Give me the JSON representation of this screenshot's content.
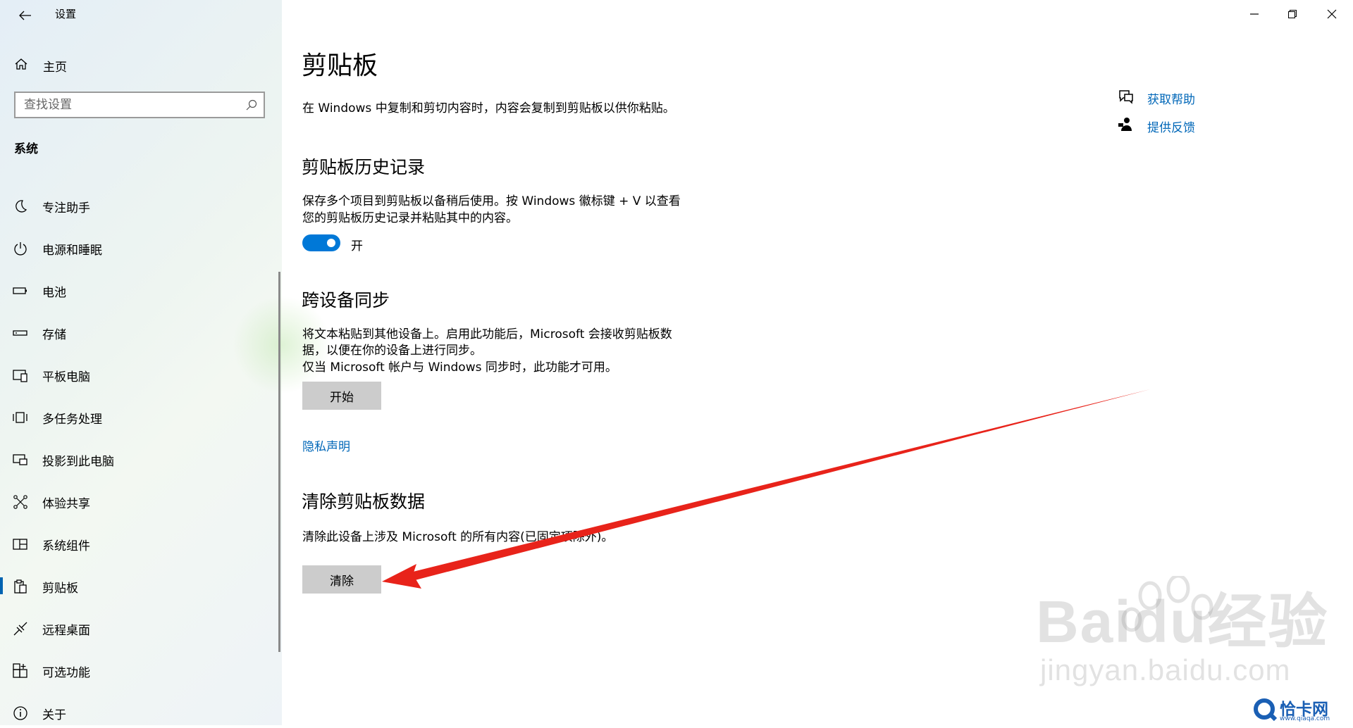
{
  "app": {
    "title": "设置"
  },
  "sidebar": {
    "home_label": "主页",
    "search_placeholder": "查找设置",
    "group_label": "系统",
    "items": [
      {
        "label": "专注助手",
        "icon": "moon-icon"
      },
      {
        "label": "电源和睡眠",
        "icon": "power-icon"
      },
      {
        "label": "电池",
        "icon": "battery-icon"
      },
      {
        "label": "存储",
        "icon": "storage-icon"
      },
      {
        "label": "平板电脑",
        "icon": "tablet-icon"
      },
      {
        "label": "多任务处理",
        "icon": "multitasking-icon"
      },
      {
        "label": "投影到此电脑",
        "icon": "project-icon"
      },
      {
        "label": "体验共享",
        "icon": "shared-experiences-icon"
      },
      {
        "label": "系统组件",
        "icon": "system-components-icon"
      },
      {
        "label": "剪贴板",
        "icon": "clipboard-icon",
        "active": true
      },
      {
        "label": "远程桌面",
        "icon": "remote-desktop-icon"
      },
      {
        "label": "可选功能",
        "icon": "optional-features-icon"
      },
      {
        "label": "关于",
        "icon": "info-icon"
      }
    ]
  },
  "main": {
    "title": "剪贴板",
    "description": "在 Windows 中复制和剪切内容时，内容会复制到剪贴板以供你粘贴。",
    "history": {
      "title": "剪贴板历史记录",
      "text_line1": "保存多个项目到剪贴板以备稍后使用。按 Windows 徽标键 + V 以查看",
      "text_line2": "您的剪贴板历史记录并粘贴其中的内容。",
      "toggle_on": true,
      "toggle_label": "开"
    },
    "sync": {
      "title": "跨设备同步",
      "text_line1": "将文本粘贴到其他设备上。启用此功能后，Microsoft 会接收剪贴板数",
      "text_line2": "据，以便在你的设备上进行同步。",
      "text_line3": "仅当 Microsoft 帐户与 Windows 同步时，此功能才可用。",
      "button_label": "开始"
    },
    "privacy_link": "隐私声明",
    "clear": {
      "title": "清除剪贴板数据",
      "text": "清除此设备上涉及 Microsoft 的所有内容(已固定项除外)。",
      "button_label": "清除"
    },
    "help": {
      "get_help": "获取帮助",
      "feedback": "提供反馈"
    }
  },
  "annotation": {
    "color": "#e8231a"
  },
  "watermark": {
    "brand": "Baidu经验",
    "url": "jingyan.baidu.com",
    "site": "恰卡网",
    "site_url": "www.qiaqa.com"
  },
  "colors": {
    "accent": "#0078d7",
    "link": "#0067b8"
  }
}
